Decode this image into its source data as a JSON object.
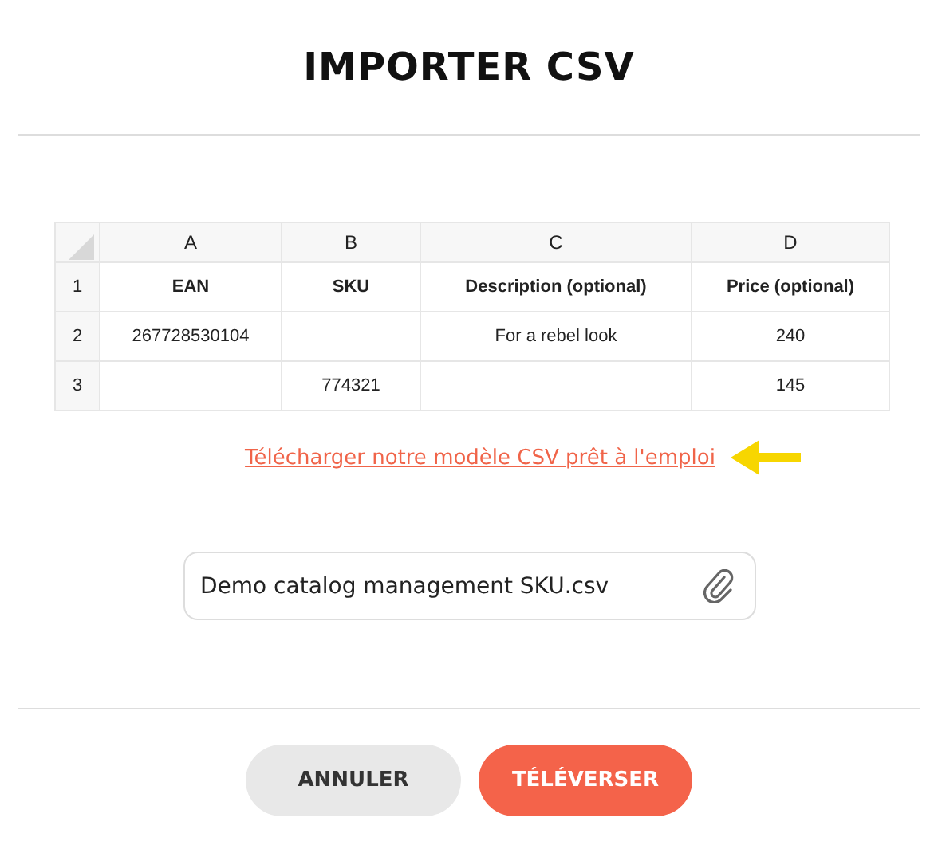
{
  "title": "IMPORTER CSV",
  "sheet": {
    "columns": [
      "A",
      "B",
      "C",
      "D"
    ],
    "rows": [
      {
        "number": "1",
        "header": true,
        "cells": [
          "EAN",
          "SKU",
          "Description (optional)",
          "Price (optional)"
        ]
      },
      {
        "number": "2",
        "header": false,
        "cells": [
          "267728530104",
          null,
          "For a rebel look",
          "240"
        ]
      },
      {
        "number": "3",
        "header": false,
        "cells": [
          null,
          "774321",
          null,
          "145"
        ]
      }
    ]
  },
  "template_link": "Télécharger notre modèle CSV prêt à l'emploi",
  "file_field": {
    "value": "Demo catalog management SKU.csv"
  },
  "buttons": [
    {
      "label": "ANNULER",
      "kind": "secondary"
    },
    {
      "label": "TÉLÉVERSER",
      "kind": "primary"
    }
  ]
}
